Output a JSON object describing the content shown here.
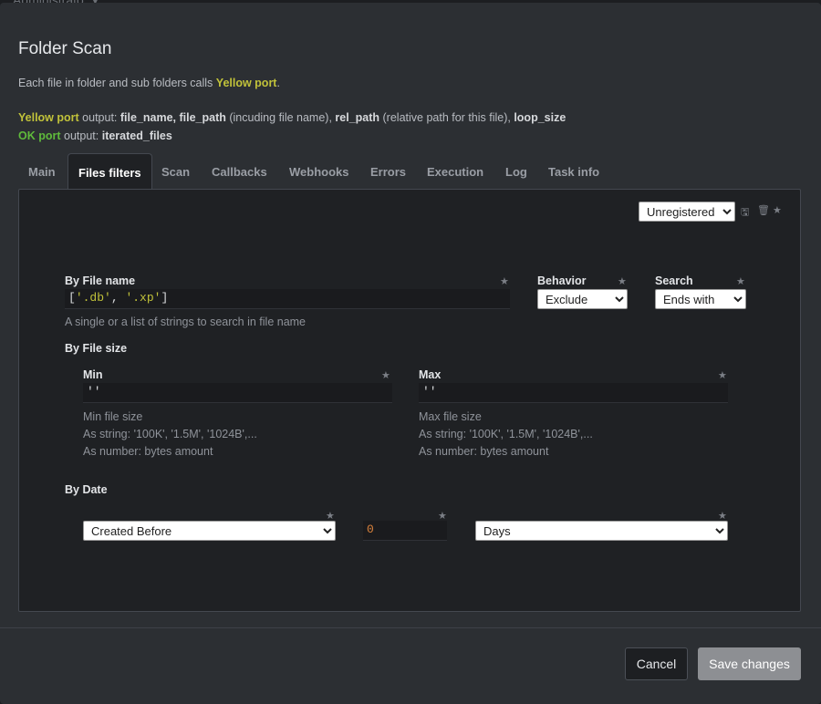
{
  "backdrop": {
    "title": "Administrato"
  },
  "modal": {
    "title": "Folder Scan",
    "description": {
      "p1_pre": "Each file in folder and sub folders calls ",
      "p1_port": "Yellow port",
      "p1_post": ".",
      "p2_port": "Yellow port",
      "p2_text1": " output: ",
      "p2_b1": "file_name, file_path",
      "p2_text2": " (incuding file name), ",
      "p2_b2": "rel_path",
      "p2_text3": " (relative path for this file), ",
      "p2_b3": "loop_size",
      "p3_port": "OK port",
      "p3_text": " output: ",
      "p3_b": "iterated_files"
    }
  },
  "tabs": [
    {
      "label": "Main"
    },
    {
      "label": "Files filters",
      "active": true
    },
    {
      "label": "Scan"
    },
    {
      "label": "Callbacks"
    },
    {
      "label": "Webhooks"
    },
    {
      "label": "Errors"
    },
    {
      "label": "Execution"
    },
    {
      "label": "Log"
    },
    {
      "label": "Task info"
    }
  ],
  "panel": {
    "preset_select": {
      "selected": "Unregistered"
    },
    "icons": {
      "save": "floppy-icon",
      "delete": "trash-icon",
      "favorite": "star-icon"
    },
    "by_file_name": {
      "label": "By File name",
      "value_open": "[",
      "value_s1": "'.db'",
      "value_sep": ", ",
      "value_s2": "'.xp'",
      "value_close": "]",
      "help": "A single or a list of strings to search in file name"
    },
    "behavior": {
      "label": "Behavior",
      "selected": "Exclude"
    },
    "search": {
      "label": "Search",
      "selected": "Ends with"
    },
    "by_file_size": {
      "label": "By File size",
      "min": {
        "label": "Min",
        "value": "''",
        "help1": "Min file size",
        "help2": "As string: '100K', '1.5M', '1024B',...",
        "help3": "As number: bytes amount"
      },
      "max": {
        "label": "Max",
        "value": "''",
        "help1": "Max file size",
        "help2": "As string: '100K', '1.5M', '1024B',...",
        "help3": "As number: bytes amount"
      }
    },
    "by_date": {
      "label": "By Date",
      "mode": {
        "selected": "Created Before"
      },
      "amount": "0",
      "unit": {
        "selected": "Days"
      }
    }
  },
  "footer": {
    "cancel_label": "Cancel",
    "save_label": "Save changes"
  },
  "colors": {
    "port_yellow": "#c1c23a",
    "port_ok": "#5fba3b",
    "modal_bg": "#2c2f33",
    "panel_bg": "#1f2124"
  }
}
